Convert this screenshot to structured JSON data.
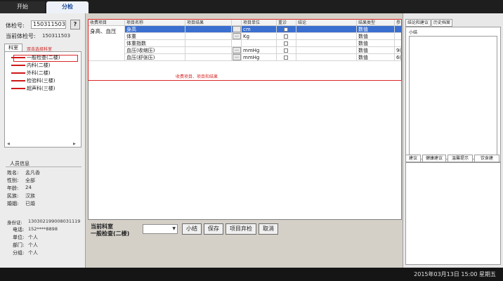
{
  "top_tabs": [
    "开始",
    "分检"
  ],
  "status_bar": {
    "datetime": "2015年03月13日 15:00 星期五"
  },
  "left": {
    "exam_no_label": "体检号:",
    "exam_no_value": "150311503",
    "help_label": "?",
    "current_exam_label": "当前体检号:",
    "current_exam_value": "150311503",
    "dept_tab": "科室",
    "dept_hint": "双击选择科室",
    "departments": [
      "一般检查(二楼)",
      "内科(二楼)",
      "外科(二楼)",
      "检验科(三楼)",
      "超声科(三楼)"
    ],
    "person_title": "人员信息",
    "person_fields": [
      {
        "label": "姓名:",
        "value": "孟凡香"
      },
      {
        "label": "性别:",
        "value": "全部"
      },
      {
        "label": "年龄:",
        "value": "24"
      },
      {
        "label": "民族:",
        "value": "汉族"
      },
      {
        "label": "婚姻:",
        "value": "已婚"
      }
    ],
    "contact_fields": [
      {
        "label": "身份证:",
        "value": "130302199008031119"
      },
      {
        "label": "电话:",
        "value": "152****8898"
      },
      {
        "label": "单位:",
        "value": "个人"
      },
      {
        "label": "部门:",
        "value": "个人"
      },
      {
        "label": "分组:",
        "value": "个人"
      }
    ]
  },
  "grid": {
    "headers": [
      "收费项目",
      "项目名称",
      "项目结果",
      "",
      "项目单位",
      "重诊",
      "结论",
      "结果类型",
      "参"
    ],
    "group_label": "身高、血压",
    "rows": [
      {
        "name": "身高",
        "result": "",
        "unit": "cm",
        "type": "数值",
        "ref": "",
        "selected": true
      },
      {
        "name": "体重",
        "result": "",
        "unit": "Kg",
        "type": "数值",
        "ref": "",
        "selected": false
      },
      {
        "name": "体重指数",
        "result": "",
        "unit": "",
        "type": "数值",
        "ref": "",
        "selected": false
      },
      {
        "name": "血压(收缩压)",
        "result": "",
        "unit": "mmHg",
        "type": "数值",
        "ref": "9(",
        "selected": false
      },
      {
        "name": "血压(舒张压)",
        "result": "",
        "unit": "mmHg",
        "type": "数值",
        "ref": "6(",
        "selected": false
      }
    ],
    "ellipsis": "...",
    "note": "收费项目、项目和结果"
  },
  "actions": {
    "current_dept_label": "当前科室",
    "current_dept_value": "一般检查(二楼)",
    "combo_arrow": "▼",
    "buttons": [
      "小结",
      "保存",
      "项目弃检",
      "取消"
    ]
  },
  "right": {
    "top_tabs": [
      "结论和建议",
      "历史档案"
    ],
    "summary_label": "小结",
    "bottom_tabs": [
      "建议",
      "健康建议",
      "温馨提示",
      "饮食建"
    ]
  }
}
